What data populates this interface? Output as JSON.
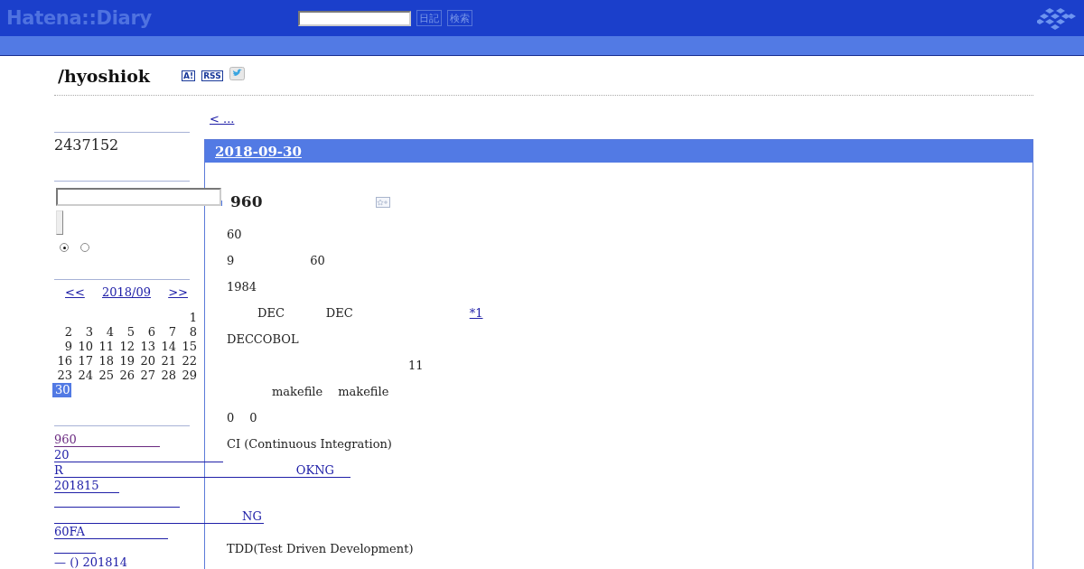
{
  "header": {
    "logo": "Hatena::Diary",
    "buttons": [
      "日記",
      "検索"
    ]
  },
  "blog_title": "/hyoshiok",
  "title_badges": [
    "A!",
    "RSS"
  ],
  "sidebar": {
    "counter": "2437152",
    "search_options": [
      {
        "selected": true
      },
      {
        "selected": false
      }
    ],
    "calendar": {
      "prev": "<<",
      "month": "2018/09",
      "next": ">>",
      "weeks": [
        [
          {
            "day": "1",
            "selected": false
          }
        ],
        [
          {
            "day": "2",
            "selected": false
          },
          {
            "day": "3",
            "selected": false
          },
          {
            "day": "4",
            "selected": false
          },
          {
            "day": "5",
            "selected": false
          },
          {
            "day": "6",
            "selected": false
          },
          {
            "day": "7",
            "selected": false
          },
          {
            "day": "8",
            "selected": false
          }
        ],
        [
          {
            "day": "9",
            "selected": false
          },
          {
            "day": "10",
            "selected": false
          },
          {
            "day": "11",
            "selected": false
          },
          {
            "day": "12",
            "selected": false
          },
          {
            "day": "13",
            "selected": false
          },
          {
            "day": "14",
            "selected": false
          },
          {
            "day": "15",
            "selected": false
          }
        ],
        [
          {
            "day": "16",
            "selected": false
          },
          {
            "day": "17",
            "selected": false
          },
          {
            "day": "18",
            "selected": false
          },
          {
            "day": "19",
            "selected": false
          },
          {
            "day": "20",
            "selected": false
          },
          {
            "day": "21",
            "selected": false
          },
          {
            "day": "22",
            "selected": false
          }
        ],
        [
          {
            "day": "23",
            "selected": false
          },
          {
            "day": "24",
            "selected": false
          },
          {
            "day": "25",
            "selected": false
          },
          {
            "day": "26",
            "selected": false
          },
          {
            "day": "27",
            "selected": false
          },
          {
            "day": "28",
            "selected": false
          },
          {
            "day": "29",
            "selected": false
          }
        ],
        [
          {
            "day": "30",
            "selected": true
          }
        ]
      ]
    },
    "recent": [
      {
        "parts": [
          "960"
        ],
        "visited": true
      },
      {
        "parts": [
          "20"
        ],
        "visited": false
      },
      {
        "parts": [
          "R",
          "OKNG"
        ],
        "visited": false
      },
      {
        "parts": [
          "201815"
        ],
        "visited": false
      },
      {
        "kind": "blank",
        "visited": false
      },
      {
        "parts": [
          "NG"
        ],
        "visited": false
      },
      {
        "parts": [
          "60FA"
        ],
        "visited": false
      },
      {
        "kind": "blank",
        "visited": false
      },
      {
        "parts": [
          "— () 201814"
        ],
        "visited": false
      }
    ]
  },
  "main": {
    "prev_link": "< ...",
    "date": "2018-09-30",
    "section_title": "960",
    "paragraphs": [
      {
        "kind": "text",
        "segments": [
          {
            "text": "60"
          }
        ]
      },
      {
        "kind": "text",
        "segments": [
          {
            "text": "9"
          },
          {
            "text": "60"
          }
        ]
      },
      {
        "kind": "text",
        "segments": [
          {
            "text": "1984"
          }
        ]
      },
      {
        "kind": "text",
        "segments": [
          {
            "text": "DEC"
          },
          {
            "text": "DEC"
          },
          {
            "text": "*1",
            "kind": "footnote"
          }
        ]
      },
      {
        "kind": "text",
        "segments": [
          {
            "text": "DECCOBOL"
          }
        ]
      },
      {
        "kind": "text",
        "segments": [
          {
            "text": "11"
          }
        ]
      },
      {
        "kind": "text",
        "segments": [
          {
            "text": "makefile"
          },
          {
            "text": "makefile"
          }
        ]
      },
      {
        "kind": "text",
        "segments": [
          {
            "text": "0"
          },
          {
            "text": "0"
          }
        ]
      },
      {
        "kind": "text",
        "segments": [
          {
            "text": "CI (Continuous Integration)"
          }
        ]
      },
      {
        "kind": "blank"
      },
      {
        "kind": "blank"
      },
      {
        "kind": "blank"
      },
      {
        "kind": "text",
        "segments": [
          {
            "text": "TDD(Test Driven Development)"
          }
        ]
      }
    ]
  }
}
